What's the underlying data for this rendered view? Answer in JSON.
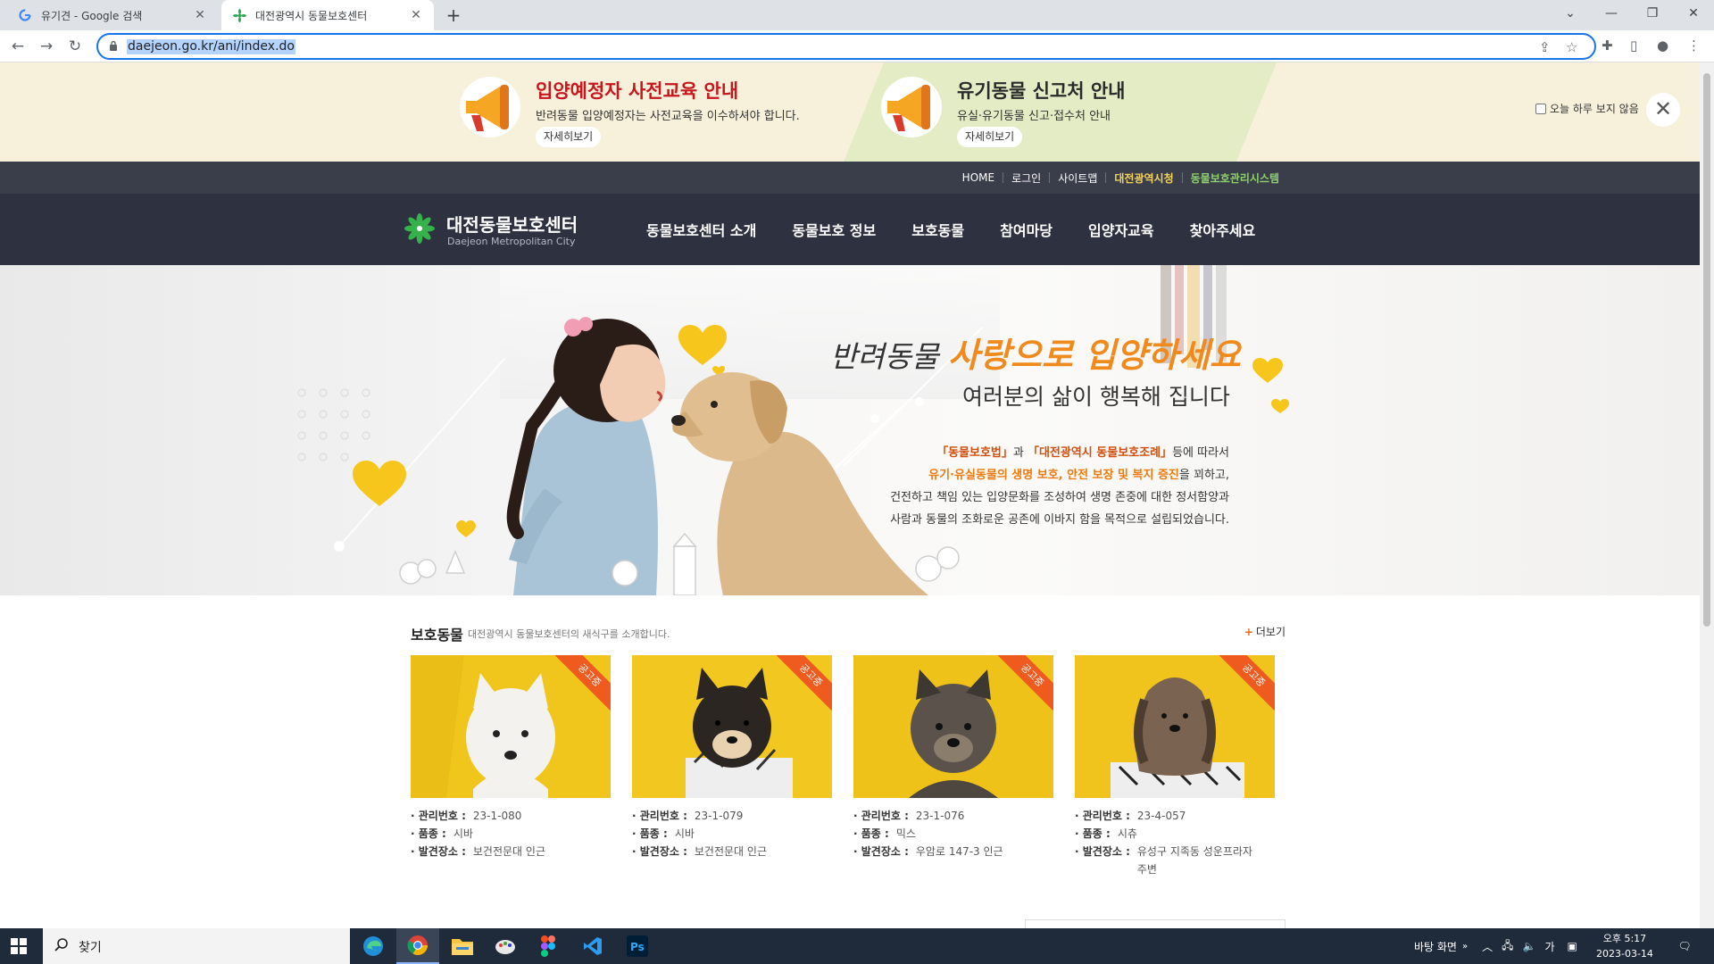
{
  "browser": {
    "tabs": [
      {
        "title": "유기견 - Google 검색",
        "icon": "google-icon",
        "active": false
      },
      {
        "title": "대전광역시 동물보호센터",
        "icon": "daejeon-logo-icon",
        "active": true
      }
    ],
    "new_tab_label": "+",
    "url": "daejeon.go.kr/ani/index.do"
  },
  "notice": {
    "items": [
      {
        "title": "입양예정자 사전교육 안내",
        "desc": "반려동물 입양예정자는 사전교육을 이수하셔야 합니다.",
        "more": "자세히보기",
        "title_color": "#c8161d"
      },
      {
        "title": "유기동물 신고처 안내",
        "desc": "유실·유기동물 신고·접수처 안내",
        "more": "자세히보기",
        "title_color": "#2a2a2a"
      }
    ],
    "hide_today_label": "오늘 하루 보지 않음"
  },
  "util_links": [
    {
      "label": "HOME",
      "style": "normal"
    },
    {
      "label": "로그인",
      "style": "normal"
    },
    {
      "label": "사이트맵",
      "style": "normal"
    },
    {
      "label": "대전광역시청",
      "style": "yellow"
    },
    {
      "label": "동물보호관리시스템",
      "style": "green"
    }
  ],
  "site": {
    "logo_title": "대전동물보호센터",
    "logo_sub": "Daejeon Metropolitan City"
  },
  "menu": [
    "동물보호센터 소개",
    "동물보호 정보",
    "보호동물",
    "참여마당",
    "입양자교육",
    "찾아주세요"
  ],
  "hero": {
    "line1_a": "반려동물 ",
    "line1_b": "사랑으로 입양하세요",
    "line2": "여러분의 삶이 행복해 집니다",
    "p1_law1": "「동물보호법」",
    "p1_mid": "과 ",
    "p1_law2": "「대전광역시 동물보호조례」",
    "p1_end": "등에 따라서",
    "p2_hl": "유기·유실동물의 생명 보호, 안전 보장 및 복지 증진",
    "p2_end": "을 꾀하고,",
    "p3": "건전하고 책임 있는 입양문화를 조성하여 생명 존중에 대한 정서함양과",
    "p4": "사람과 동물의 조화로운 공존에 이바지 함을 목적으로 설립되었습니다."
  },
  "animals_section": {
    "title": "보호동물",
    "desc": "대전광역시 동물보호센터의 새식구를 소개합니다.",
    "more": "더보기",
    "ribbon": "공고중",
    "labels": {
      "id": "관리번호 :",
      "breed": "품종 :",
      "place": "발견장소 :"
    },
    "items": [
      {
        "id": "23-1-080",
        "breed": "시바",
        "place": "보건전문대 인근",
        "fur": "#f4f2ee"
      },
      {
        "id": "23-1-079",
        "breed": "시바",
        "place": "보건전문대 인근",
        "fur": "#2b2622"
      },
      {
        "id": "23-1-076",
        "breed": "믹스",
        "place": "우암로 147-3 인근",
        "fur": "#5b534b"
      },
      {
        "id": "23-4-057",
        "breed": "시츄",
        "place": "유성구 지족동 성운프라자 주변",
        "fur": "#7a6350"
      }
    ]
  },
  "taskbar": {
    "search_placeholder": "찾기",
    "tray_desktop": "바탕 화면",
    "tray_lang": "가",
    "time": "오후 5:17",
    "date": "2023-03-14"
  }
}
